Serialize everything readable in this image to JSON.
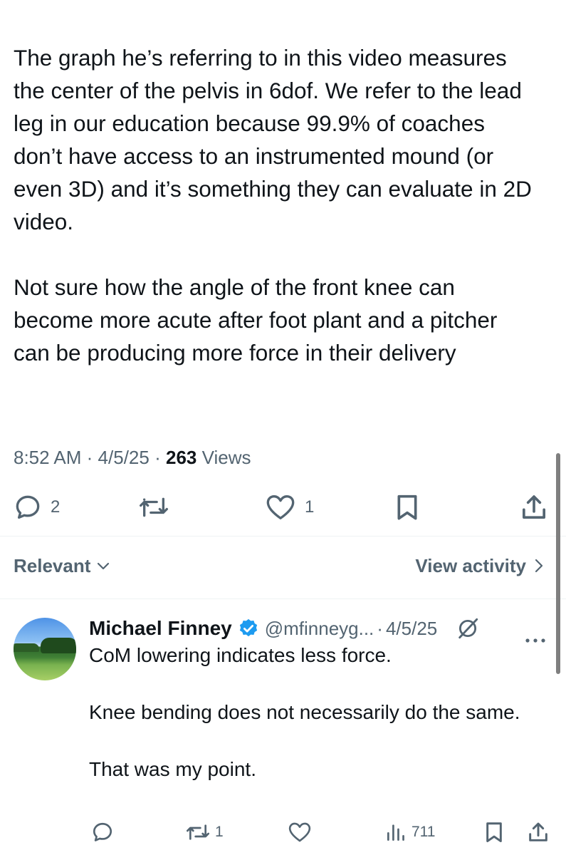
{
  "tweet": {
    "paragraphs": [
      "The graph he’s referring to in this video measures the center of the pelvis in 6dof. We refer to the lead leg in our education because 99.9% of coaches don’t have access to an instrumented mound (or even 3D) and it’s something they can evaluate in 2D video.",
      "Not sure how the angle of the front knee can become more acute after foot plant and a pitcher can be producing more force in their delivery"
    ],
    "time": "8:52 AM",
    "date": "4/5/25",
    "separator": "·",
    "views_count": "263",
    "views_label": "Views",
    "actions": {
      "replies": "2",
      "reposts": "",
      "likes": "1"
    }
  },
  "icons": {
    "reply": "reply-bubble-icon",
    "repost": "repost-arrows-icon",
    "like": "heart-icon",
    "bookmark": "bookmark-icon",
    "share": "share-upload-icon",
    "views": "bar-chart-icon",
    "verified": "verified-badge-icon",
    "grok": "grok-icon",
    "more": "more-dots-icon"
  },
  "colors": {
    "text": "#0f1419",
    "secondary": "#536471",
    "verified": "#1d9bf0",
    "divider": "#eff3f4"
  },
  "filter": {
    "sort_label": "Relevant",
    "activity_label": "View activity"
  },
  "reply": {
    "author_name": "Michael Finney",
    "handle": "@mfinneyg...",
    "separator": "·",
    "date": "4/5/25",
    "paragraphs": [
      "CoM lowering indicates less force.",
      "Knee bending does not necessarily do the same.",
      "That was my point."
    ],
    "actions": {
      "replies": "",
      "reposts": "1",
      "likes": "",
      "views": "711"
    }
  }
}
